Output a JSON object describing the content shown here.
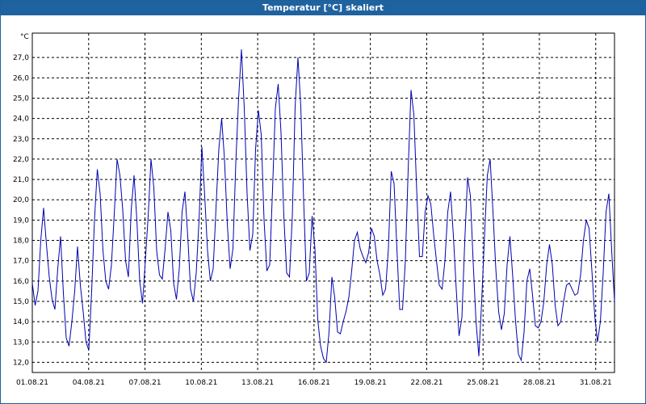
{
  "window": {
    "title": "Temperatur [°C] skaliert"
  },
  "colors": {
    "titlebar": "#1f62a0",
    "line": "#0000b0",
    "grid": "#000000",
    "background": "#ffffff"
  },
  "chart_data": {
    "type": "line",
    "title": "Temperatur [°C] skaliert",
    "ylabel": "°C",
    "xlabel": "",
    "ylim": [
      11.5,
      28.2
    ],
    "yticks": [
      12.0,
      13.0,
      14.0,
      15.0,
      16.0,
      17.0,
      18.0,
      19.0,
      20.0,
      21.0,
      22.0,
      23.0,
      24.0,
      25.0,
      26.0,
      27.0
    ],
    "ytick_labels": [
      "12,0",
      "13,0",
      "14,0",
      "15,0",
      "16,0",
      "17,0",
      "18,0",
      "19,0",
      "20,0",
      "21,0",
      "22,0",
      "23,0",
      "24,0",
      "25,0",
      "26,0",
      "27,0"
    ],
    "x_range_days": [
      0,
      31
    ],
    "x_tick_labels": [
      "01.08.21",
      "04.08.21",
      "07.08.21",
      "10.08.21",
      "13.08.21",
      "16.08.21",
      "19.08.21",
      "22.08.21",
      "25.08.21",
      "28.08.21",
      "31.08.21"
    ],
    "x_ticks_days": [
      0,
      3,
      6,
      9,
      12,
      15,
      18,
      21,
      24,
      27,
      30
    ],
    "grid": true,
    "series": [
      {
        "values": [
          15.9,
          14.8,
          15.5,
          18.0,
          19.6,
          17.8,
          16.2,
          15.1,
          14.6,
          16.6,
          18.2,
          15.4,
          13.2,
          12.8,
          14.0,
          15.5,
          17.7,
          15.8,
          14.5,
          13.0,
          12.6,
          15.5,
          19.0,
          21.5,
          20.3,
          17.5,
          16.0,
          15.6,
          16.8,
          19.3,
          22.0,
          21.2,
          19.5,
          17.0,
          16.2,
          19.5,
          21.2,
          19.0,
          16.0,
          14.9,
          17.0,
          19.2,
          22.0,
          20.6,
          17.5,
          16.3,
          16.1,
          17.6,
          19.4,
          18.5,
          15.9,
          15.1,
          16.6,
          19.4,
          20.4,
          18.2,
          15.6,
          15.0,
          16.4,
          19.0,
          22.6,
          20.2,
          17.5,
          16.0,
          16.6,
          19.6,
          22.5,
          24.0,
          22.0,
          18.8,
          16.6,
          17.6,
          21.8,
          25.0,
          27.4,
          24.5,
          20.3,
          17.5,
          18.3,
          22.5,
          24.4,
          23.2,
          19.0,
          16.5,
          16.8,
          20.5,
          24.5,
          25.7,
          23.3,
          19.2,
          16.4,
          16.2,
          19.2,
          24.6,
          27.0,
          24.6,
          20.0,
          16.0,
          16.4,
          19.2,
          17.6,
          14.1,
          12.8,
          12.2,
          12.0,
          13.5,
          16.2,
          15.2,
          13.5,
          13.4,
          14.0,
          14.5,
          15.2,
          16.5,
          18.0,
          18.4,
          17.6,
          17.2,
          16.9,
          17.4,
          18.6,
          18.2,
          17.0,
          16.3,
          15.3,
          15.6,
          17.6,
          21.4,
          20.8,
          17.6,
          14.6,
          14.6,
          17.0,
          21.5,
          25.4,
          24.2,
          20.5,
          17.2,
          17.2,
          19.4,
          20.2,
          19.8,
          18.3,
          17.0,
          15.8,
          15.6,
          17.0,
          19.4,
          20.4,
          18.2,
          15.6,
          13.3,
          14.2,
          17.9,
          21.1,
          20.2,
          16.9,
          14.0,
          12.3,
          15.0,
          18.2,
          21.2,
          22.0,
          19.4,
          16.6,
          14.5,
          13.6,
          14.4,
          16.8,
          18.2,
          16.2,
          14.0,
          12.4,
          12.1,
          13.5,
          16.0,
          16.6,
          15.3,
          13.8,
          13.7,
          14.0,
          15.0,
          16.8,
          17.8,
          16.8,
          14.8,
          13.8,
          14.0,
          15.0,
          15.8,
          15.9,
          15.6,
          15.3,
          15.4,
          16.3,
          18.0,
          19.0,
          18.6,
          16.5,
          14.3,
          13.0,
          14.0,
          16.4,
          19.4,
          20.3,
          17.5,
          15.0
        ]
      }
    ]
  }
}
